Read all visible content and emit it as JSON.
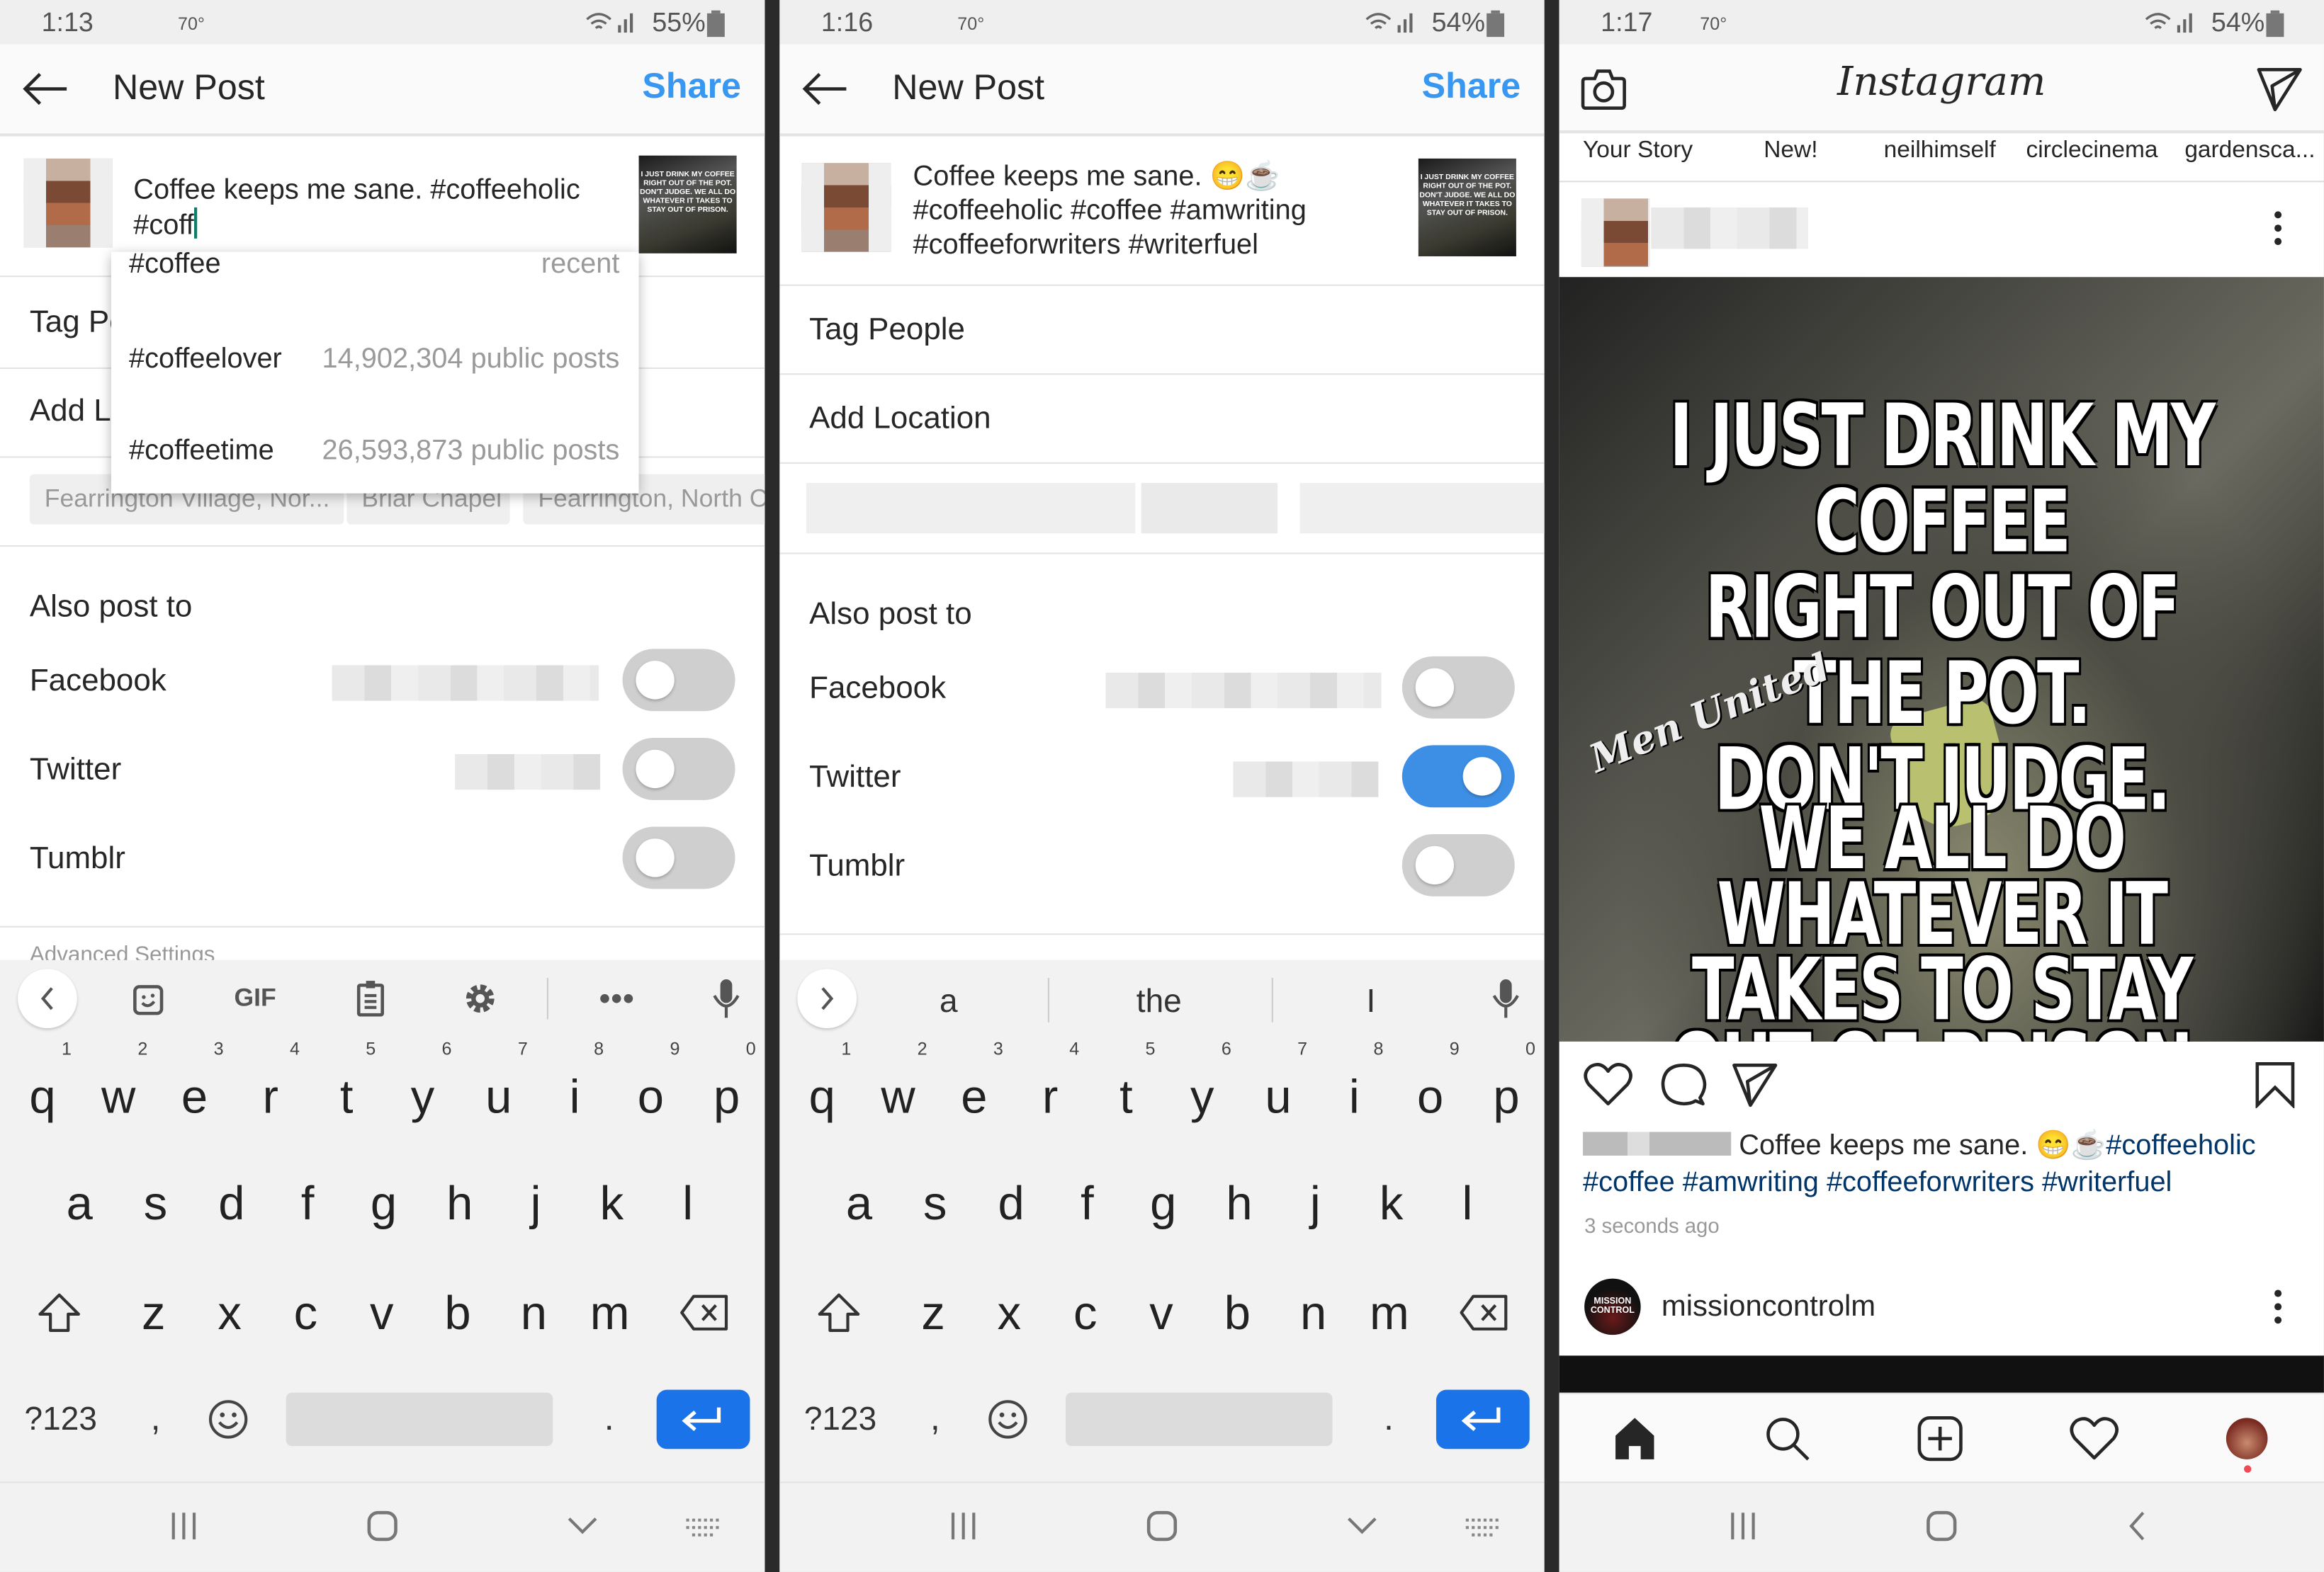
{
  "colors": {
    "accent": "#3897f0",
    "toggle_on": "#3d8fe5",
    "hashtag": "#003569",
    "enter_key": "#1a73e8"
  },
  "panels": [
    {
      "status": {
        "time": "1:13",
        "temp": "70°",
        "battery": "55%"
      },
      "header": {
        "title": "New Post",
        "share": "Share"
      },
      "caption": "Coffee keeps me sane. #coffeeholic\n#coff",
      "thumbnail_text": "I JUST DRINK MY COFFEE RIGHT OUT OF THE POT. DON'T JUDGE. WE ALL DO WHATEVER IT TAKES TO STAY OUT OF PRISON.",
      "tag_people": "Tag People",
      "add_location": "Add Location",
      "location_chips": [
        "Fearrington Village, Nor...",
        "Briar Chapel",
        "Fearrington, North C"
      ],
      "also_post_to": "Also post to",
      "shares": [
        {
          "label": "Facebook",
          "on": false
        },
        {
          "label": "Twitter",
          "on": false
        },
        {
          "label": "Tumblr",
          "on": false
        }
      ],
      "advanced": "Advanced Settings",
      "suggestions": [
        {
          "tag": "#coffee",
          "meta": "recent"
        },
        {
          "tag": "#coffeelover",
          "meta": "14,902,304 public posts"
        },
        {
          "tag": "#coffeetime",
          "meta": "26,593,873 public posts"
        }
      ],
      "toolbar": {
        "gif": "GIF",
        "icons": [
          "chevron-left-icon",
          "sticker-icon",
          "gif-icon",
          "clipboard-icon",
          "gear-icon",
          "more-icon",
          "mic-icon"
        ]
      }
    },
    {
      "status": {
        "time": "1:16",
        "temp": "70°",
        "battery": "54%"
      },
      "header": {
        "title": "New Post",
        "share": "Share"
      },
      "caption": "Coffee keeps me sane. 😁☕\n#coffeeholic #coffee #amwriting\n#coffeeforwriters #writerfuel",
      "tag_people": "Tag People",
      "add_location": "Add Location",
      "also_post_to": "Also post to",
      "shares": [
        {
          "label": "Facebook",
          "on": false
        },
        {
          "label": "Twitter",
          "on": true
        },
        {
          "label": "Tumblr",
          "on": false
        }
      ],
      "word_suggestions": [
        "a",
        "the",
        "I"
      ]
    },
    {
      "status": {
        "time": "1:17",
        "temp": "70°",
        "battery": "54%"
      },
      "logo": "Instagram",
      "stories": [
        "Your Story",
        "New!",
        "neilhimself",
        "circlecinema",
        "gardensca..."
      ],
      "meme": {
        "top": [
          "I JUST DRINK MY COFFEE",
          "RIGHT OUT OF THE POT.",
          "DON'T JUDGE."
        ],
        "watermark": "Men United",
        "bottom": [
          "WE ALL DO WHATEVER IT",
          "TAKES TO STAY",
          "OUT OF PRISON."
        ]
      },
      "caption_text": "Coffee keeps me sane. 😁☕",
      "caption_tag1": "#coffeeholic",
      "caption_tags2": "#coffee #amwriting #coffeeforwriters #writerfuel",
      "time_ago": "3 seconds ago",
      "next_user": "missioncontrolm",
      "next_user_logo": "MISSION CONTROL"
    }
  ],
  "keyboard": {
    "row1": [
      [
        "q",
        "1"
      ],
      [
        "w",
        "2"
      ],
      [
        "e",
        "3"
      ],
      [
        "r",
        "4"
      ],
      [
        "t",
        "5"
      ],
      [
        "y",
        "6"
      ],
      [
        "u",
        "7"
      ],
      [
        "i",
        "8"
      ],
      [
        "o",
        "9"
      ],
      [
        "p",
        "0"
      ]
    ],
    "row2": [
      "a",
      "s",
      "d",
      "f",
      "g",
      "h",
      "j",
      "k",
      "l"
    ],
    "row3": [
      "z",
      "x",
      "c",
      "v",
      "b",
      "n",
      "m"
    ],
    "symbols": "?123",
    "comma": ",",
    "period": "."
  }
}
